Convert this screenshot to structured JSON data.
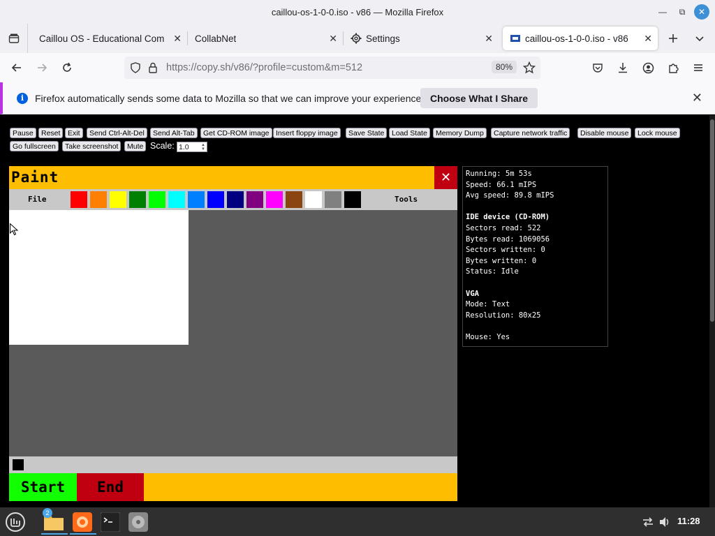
{
  "window": {
    "title": "caillou-os-1-0-0.iso - v86 — Mozilla Firefox"
  },
  "tabs": [
    {
      "label": "Caillou OS - Educational Compu"
    },
    {
      "label": "CollabNet"
    },
    {
      "label": "Settings"
    },
    {
      "label": "caillou-os-1-0-0.iso - v86"
    }
  ],
  "navbar": {
    "url": "https://copy.sh/v86/?profile=custom&m=512",
    "zoom": "80%"
  },
  "notification": {
    "message": "Firefox automatically sends some data to Mozilla so that we can improve your experience.",
    "button": "Choose What I Share"
  },
  "controls": {
    "buttons": [
      "Pause",
      "Reset",
      "Exit",
      "Send Ctrl-Alt-Del",
      "Send Alt-Tab",
      "Get CD-ROM image",
      "Insert floppy image",
      "Save State",
      "Load State",
      "Memory Dump",
      "Capture network traffic",
      "Disable mouse",
      "Lock mouse",
      "Go fullscreen",
      "Take screenshot",
      "Mute"
    ],
    "scale_label": "Scale:",
    "scale_value": "1.0"
  },
  "paint": {
    "title": "Paint",
    "menu_file": "File",
    "menu_tools": "Tools",
    "palette": [
      "#ff0000",
      "#ff8000",
      "#ffff00",
      "#008000",
      "#00ff00",
      "#00ffff",
      "#0080ff",
      "#0000ff",
      "#000080",
      "#800080",
      "#ff00ff",
      "#8b4513",
      "#ffffff",
      "#808080",
      "#000000"
    ],
    "start": "Start",
    "end": "End"
  },
  "stats": {
    "running": "Running: 5m 53s",
    "speed": "Speed: 66.1 mIPS",
    "avg_speed": "Avg speed: 89.8 mIPS",
    "ide_header": "IDE device (CD-ROM)",
    "sectors_read": "Sectors read: 522",
    "bytes_read": "Bytes read: 1069056",
    "sectors_written": "Sectors written: 0",
    "bytes_written": "Bytes written: 0",
    "status": "Status: Idle",
    "vga_header": "VGA",
    "mode": "Mode: Text",
    "resolution": "Resolution: 80x25",
    "mouse": "Mouse: Yes"
  },
  "os_taskbar": {
    "badge": "2",
    "clock": "11:28"
  }
}
